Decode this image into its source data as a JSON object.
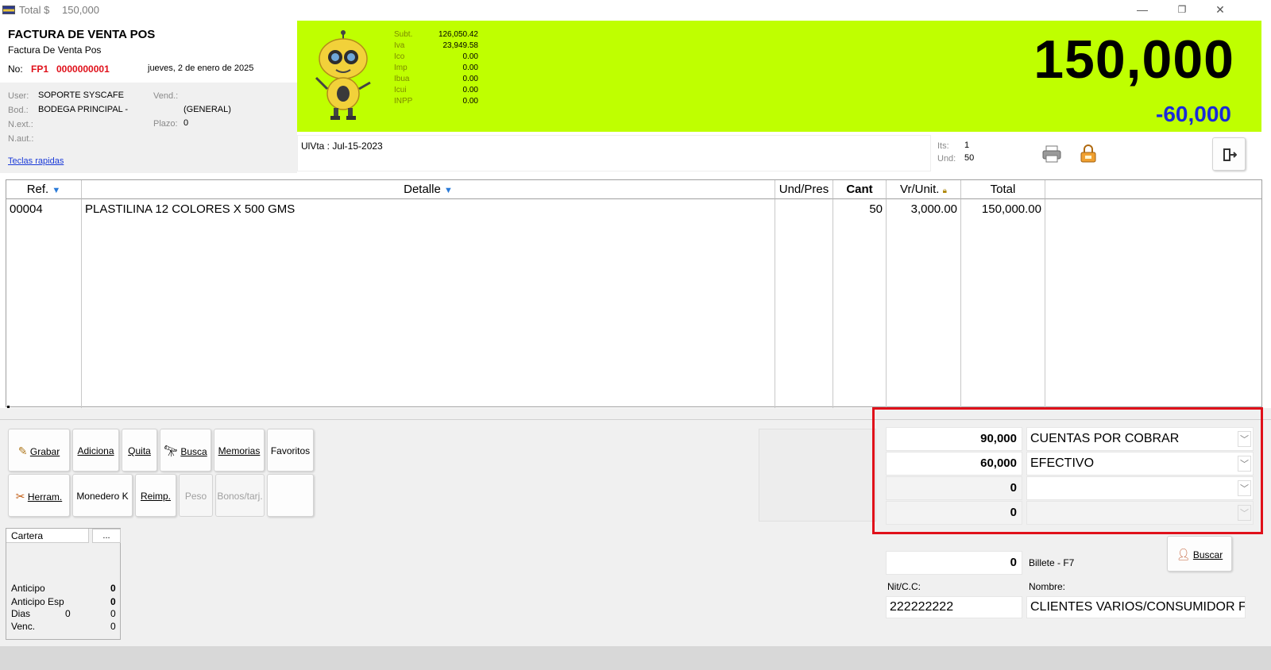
{
  "window": {
    "title": "Total $",
    "title_value": "150,000",
    "min": "—",
    "restore": "❐",
    "close": "✕"
  },
  "header": {
    "doc_title": "FACTURA DE VENTA POS",
    "doc_subtitle": "Factura De Venta Pos",
    "no_label": "No:",
    "prefix": "FP1",
    "number": "0000000001",
    "date": "jueves, 2 de enero de 2025",
    "user_label": "User:",
    "user": "SOPORTE SYSCAFE",
    "bod_label": "Bod.:",
    "bod": "BODEGA PRINCIPAL -",
    "next_label": "N.ext.:",
    "naut_label": "N.aut.:",
    "vend_label": "Vend.:",
    "vend": "(GENERAL)",
    "plazo_label": "Plazo:",
    "plazo": "0",
    "hotkeys_link": "Teclas rapidas"
  },
  "totals": {
    "rows": [
      {
        "label": "Subt.",
        "value": "126,050.42"
      },
      {
        "label": "Iva",
        "value": "23,949.58"
      },
      {
        "label": "Ico",
        "value": "0.00"
      },
      {
        "label": "Imp",
        "value": "0.00"
      },
      {
        "label": "Ibua",
        "value": "0.00"
      },
      {
        "label": "Icui",
        "value": "0.00"
      },
      {
        "label": "INPP",
        "value": "0.00"
      }
    ],
    "big_total": "150,000",
    "balance": "-60,000"
  },
  "last_sale": "UlVta : Jul-15-2023",
  "counters": {
    "its_label": "Its:",
    "its": "1",
    "und_label": "Und:",
    "und": "50"
  },
  "grid": {
    "headers": [
      "Ref.",
      "Detalle",
      "Und/Pres",
      "Cant",
      "Vr/Unit.",
      "Total"
    ],
    "rows": [
      {
        "ref": "00004",
        "detalle": "PLASTILINA 12 COLORES X 500 GMS",
        "und": "",
        "cant": "50",
        "vr_unit": "3,000.00",
        "total": "150,000.00"
      }
    ]
  },
  "buttons": {
    "grabar": "Grabar",
    "adiciona": "Adiciona",
    "quita": "Quita",
    "busca": "Busca",
    "memorias": "Memorias",
    "favoritos": "Favoritos",
    "herram": "Herram.",
    "monedero": "Monedero K",
    "reimp": "Reimp.",
    "peso": "Peso",
    "bonos": "Bonos/tarj."
  },
  "cartera": {
    "title": "Cartera",
    "more": "...",
    "anticipo_label": "Anticipo",
    "anticipo": "0",
    "anticipo_esp_label": "Anticipo Esp",
    "anticipo_esp": "0",
    "dias_label": "Dias",
    "dias": "0",
    "dias_val2": "0",
    "venc_label": "Venc.",
    "venc": "0"
  },
  "payments": [
    {
      "amount": "90,000",
      "method": "CUENTAS POR COBRAR"
    },
    {
      "amount": "60,000",
      "method": "EFECTIVO"
    },
    {
      "amount": "0",
      "method": ""
    },
    {
      "amount": "0",
      "method": ""
    }
  ],
  "billete": {
    "amount": "0",
    "label": "Billete - F7"
  },
  "buscar": "Buscar",
  "customer": {
    "nit_label": "Nit/C.C:",
    "nit": "222222222",
    "name_label": "Nombre:",
    "name": "CLIENTES VARIOS/CONSUMIDOR FIN"
  },
  "colors": {
    "accent_green": "#bfff00",
    "highlight_red": "#e0101a",
    "balance_blue": "#1a2ad8",
    "doc_red": "#e0101a"
  }
}
